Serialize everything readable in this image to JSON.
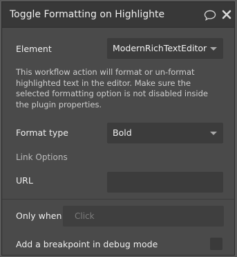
{
  "window": {
    "title": "Toggle Formatting on Highlighte"
  },
  "icons": {
    "comment": "comment-icon",
    "close": "close-icon"
  },
  "element_field": {
    "label": "Element",
    "value": "ModernRichTextEditor A"
  },
  "description": "This workflow action will format or un-format highlighted text in the editor. Make sure the selected formatting option is not disabled inside the plugin properties.",
  "format_type": {
    "label": "Format type",
    "value": "Bold"
  },
  "link_options": {
    "label": "Link Options",
    "url_label": "URL",
    "url_value": ""
  },
  "only_when": {
    "label": "Only when",
    "placeholder": "Click"
  },
  "breakpoint": {
    "label": "Add a breakpoint in debug mode",
    "checked": false
  }
}
